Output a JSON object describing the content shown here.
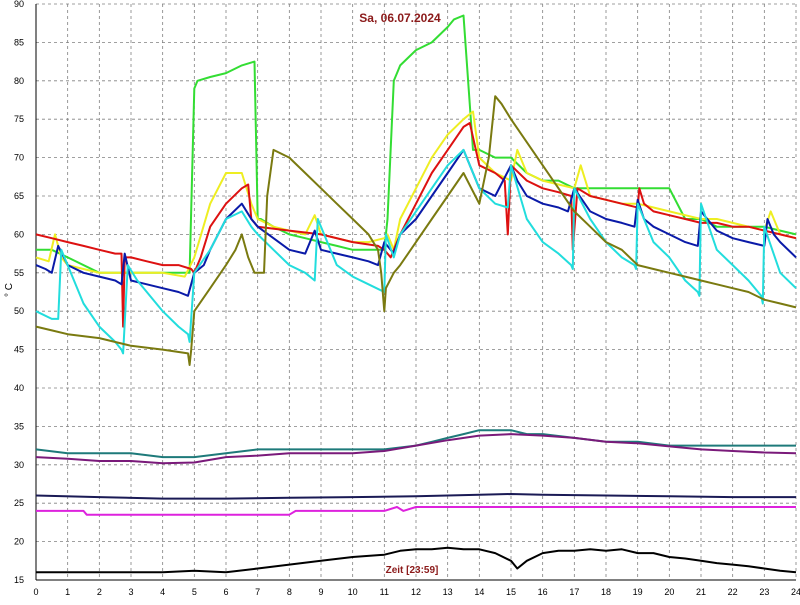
{
  "chart_data": {
    "type": "line",
    "title": "Sa, 06.07.2024",
    "xlabel": "Zeit [23:59]",
    "ylabel": "° C",
    "xlim": [
      0,
      24
    ],
    "ylim": [
      15,
      90
    ],
    "xticks": [
      0,
      1,
      2,
      3,
      4,
      5,
      6,
      7,
      8,
      9,
      10,
      11,
      12,
      13,
      14,
      15,
      16,
      17,
      18,
      19,
      20,
      21,
      22,
      23,
      24
    ],
    "yticks": [
      15,
      20,
      25,
      30,
      35,
      40,
      45,
      50,
      55,
      60,
      65,
      70,
      75,
      80,
      85,
      90
    ],
    "grid": true,
    "colors": {
      "title": "#8b1a1a",
      "xlabel": "#8b1a1a",
      "grid": "#808080",
      "axis": "#000000"
    },
    "series": [
      {
        "color": "#33dd33",
        "x": [
          0,
          0.5,
          1,
          2,
          3,
          4,
          4.75,
          4.85,
          5.0,
          5.1,
          5.5,
          6,
          6.5,
          6.9,
          7.0,
          7.1,
          7.5,
          8,
          8.5,
          9,
          9.5,
          10,
          10.5,
          11.0,
          11.1,
          11.3,
          11.4,
          11.5,
          12,
          12.5,
          13,
          13.2,
          13.5,
          13.8,
          14,
          14.5,
          15,
          15.5,
          16,
          16.5,
          17,
          17.5,
          18,
          18.5,
          19,
          19.5,
          20,
          20.5,
          21,
          21.5,
          22,
          22.5,
          23,
          23.5,
          24
        ],
        "y": [
          58,
          58,
          57,
          55,
          55,
          55,
          55,
          55,
          79,
          80,
          80.5,
          81,
          82,
          82.5,
          62,
          62,
          61,
          60,
          59.5,
          59,
          58.5,
          58,
          58,
          58,
          62,
          80,
          81,
          82,
          84,
          85,
          87,
          88,
          88.5,
          71,
          71,
          70,
          70,
          68,
          67,
          67,
          66,
          66,
          66,
          66,
          66,
          66,
          66,
          62,
          62,
          61,
          61,
          61,
          61,
          60.5,
          60
        ]
      },
      {
        "color": "#eeee22",
        "x": [
          0,
          0.4,
          0.6,
          0.8,
          1,
          1.5,
          2,
          2.8,
          3,
          3.5,
          4,
          4.7,
          5.0,
          5.5,
          6,
          6.5,
          6.8,
          7,
          7.5,
          8,
          8.5,
          8.8,
          9,
          9.5,
          10,
          10.5,
          11,
          11.1,
          11.3,
          11.5,
          12,
          12.5,
          13,
          13.5,
          13.8,
          14,
          14.5,
          15,
          15.2,
          15.5,
          16,
          16.5,
          17,
          17.2,
          17.5,
          18,
          18.5,
          19,
          19.5,
          20,
          20.5,
          21,
          21.5,
          22,
          22.5,
          23,
          23.2,
          23.5,
          24
        ],
        "y": [
          57,
          56.5,
          60,
          57,
          56,
          55.5,
          55,
          55,
          55,
          55,
          55,
          54.5,
          57,
          64,
          68,
          68,
          64,
          62,
          61,
          60.5,
          60,
          62.5,
          60,
          59.5,
          59,
          59,
          59.5,
          60,
          58,
          62,
          66,
          70,
          73,
          75,
          76,
          70,
          68,
          67,
          71,
          68,
          67,
          66.5,
          66,
          69,
          65,
          64.5,
          64,
          64,
          63.5,
          63,
          62.5,
          62,
          62,
          61.5,
          61,
          60.5,
          63,
          60,
          59.5
        ]
      },
      {
        "color": "#dd1111",
        "x": [
          0,
          0.5,
          1,
          1.5,
          2,
          2.5,
          2.7,
          2.75,
          2.8,
          3,
          3.5,
          4,
          4.5,
          4.9,
          5.0,
          5.2,
          5.5,
          6,
          6.5,
          6.7,
          6.8,
          7,
          8,
          9,
          10,
          10.8,
          11,
          11.2,
          11.5,
          12,
          12.5,
          13,
          13.5,
          13.7,
          14,
          14.5,
          14.8,
          14.9,
          15,
          15.5,
          16,
          16.5,
          16.9,
          16.95,
          17.1,
          17.5,
          18,
          18.5,
          19,
          19.05,
          19.2,
          19.5,
          20,
          20.5,
          21,
          21.5,
          22,
          22.5,
          23,
          23.5,
          24
        ],
        "y": [
          60,
          59.5,
          59,
          58.5,
          58,
          57.5,
          57.5,
          48,
          57,
          57,
          56.5,
          56,
          56,
          55.5,
          55,
          57,
          61,
          64,
          66,
          66.5,
          62,
          61,
          60.5,
          60,
          59,
          58.5,
          58,
          57,
          60,
          64,
          68,
          71,
          74,
          74.5,
          69,
          68,
          67,
          60,
          69,
          67,
          66,
          65.5,
          65,
          58,
          66,
          65,
          64.5,
          64,
          63.5,
          66,
          64,
          63,
          62.5,
          62,
          61.5,
          61.5,
          61,
          61,
          60.5,
          60,
          59.5
        ]
      },
      {
        "color": "#0a1aa8",
        "x": [
          0,
          0.3,
          0.5,
          0.7,
          1,
          1.5,
          2,
          2.5,
          2.7,
          2.8,
          3,
          3.5,
          4,
          4.5,
          4.8,
          5.0,
          5.3,
          5.5,
          6,
          6.5,
          6.8,
          7,
          7.5,
          8,
          8.5,
          8.8,
          9,
          9.5,
          10,
          10.5,
          10.8,
          11,
          11.3,
          11.5,
          12,
          12.5,
          13,
          13.5,
          14,
          14.5,
          15,
          15.2,
          15.5,
          16,
          16.5,
          16.8,
          17,
          17.5,
          18,
          18.5,
          18.9,
          19.0,
          19.2,
          19.5,
          20,
          20.5,
          20.9,
          21.0,
          21.5,
          22,
          22.5,
          23,
          23.1,
          23.3,
          23.5,
          24
        ],
        "y": [
          56,
          55.5,
          55,
          58.5,
          56,
          55,
          54.5,
          54,
          53.5,
          57.5,
          54,
          53.5,
          53,
          52.5,
          52,
          55,
          56,
          58,
          62,
          64,
          62,
          61,
          59.5,
          58,
          57.5,
          60.5,
          58,
          57.5,
          57,
          56.5,
          56,
          59,
          57.5,
          60,
          62,
          65,
          68,
          71,
          66,
          65,
          69,
          67,
          65,
          64,
          63.5,
          63,
          66,
          63,
          62,
          61.5,
          61,
          64.5,
          62,
          61,
          60,
          59,
          58.5,
          63,
          60.5,
          59.5,
          59,
          58.5,
          62,
          60,
          59,
          57
        ]
      },
      {
        "color": "#22dddd",
        "x": [
          0,
          0.5,
          0.7,
          0.8,
          1.5,
          2,
          2.5,
          2.7,
          2.75,
          2.9,
          3.2,
          4,
          4.5,
          4.8,
          4.85,
          5.0,
          5.5,
          6,
          6.5,
          6.8,
          7,
          7.5,
          8,
          8.5,
          8.8,
          8.9,
          9.5,
          10,
          10.5,
          11,
          11.05,
          11.3,
          11.5,
          12,
          12.5,
          13,
          13.5,
          14,
          14.5,
          14.9,
          15.0,
          15.5,
          16,
          16.5,
          16.9,
          16.95,
          17.0,
          17.5,
          18,
          18.5,
          18.9,
          18.95,
          19.0,
          19.5,
          20,
          20.5,
          20.9,
          20.95,
          21.0,
          21.5,
          22,
          22.5,
          22.9,
          22.95,
          23.0,
          23.5,
          24
        ],
        "y": [
          50,
          49,
          49,
          58,
          51,
          48,
          46,
          45,
          44.5,
          56,
          54,
          50,
          48,
          47,
          46,
          55,
          58,
          62,
          63,
          61,
          60,
          58,
          56,
          55,
          54,
          62,
          56,
          54.5,
          53.5,
          52.5,
          60,
          57,
          60,
          63,
          66,
          69,
          71,
          66,
          64,
          63.5,
          69,
          62,
          59,
          57.5,
          56,
          55.5,
          66,
          62,
          59,
          57,
          56,
          55.5,
          64,
          59,
          57,
          54,
          52.5,
          52,
          64,
          58,
          56,
          54,
          52,
          51,
          61,
          55,
          53
        ]
      },
      {
        "color": "#7a7a10",
        "x": [
          0,
          0.5,
          1,
          2,
          3,
          4,
          4.8,
          4.85,
          4.9,
          5.0,
          5.5,
          6,
          6.3,
          6.5,
          6.7,
          6.9,
          7.2,
          7.3,
          7.5,
          8,
          8.5,
          9,
          9.5,
          10,
          10.5,
          10.8,
          10.9,
          11.0,
          11.05,
          11.3,
          11.5,
          12,
          12.5,
          13,
          13.5,
          14,
          14.3,
          14.5,
          14.7,
          15,
          15.5,
          16,
          16.5,
          17,
          17.5,
          18,
          18.5,
          19,
          19.5,
          20,
          20.5,
          21,
          21.5,
          22,
          22.5,
          23,
          23.5,
          24
        ],
        "y": [
          48,
          47.5,
          47,
          46.5,
          45.5,
          45,
          44.5,
          43,
          45,
          50,
          53,
          56,
          58,
          60,
          57,
          55,
          55,
          65,
          71,
          70,
          68,
          66,
          64,
          62,
          60,
          58,
          55,
          50,
          53,
          55,
          56,
          59,
          62,
          65,
          68,
          64,
          70,
          78,
          77,
          75,
          72,
          69,
          66,
          63,
          61,
          59,
          58,
          56,
          55.5,
          55,
          54.5,
          54,
          53.5,
          53,
          52.5,
          51.5,
          51,
          50.5
        ]
      },
      {
        "color": "#1e7a7a",
        "x": [
          0,
          1,
          2,
          3,
          4,
          5,
          6,
          7,
          8,
          9,
          10,
          11,
          12,
          12.5,
          13,
          13.5,
          14,
          14.5,
          15,
          15.5,
          16,
          17,
          18,
          19,
          20,
          21,
          22,
          23,
          24
        ],
        "y": [
          32,
          31.5,
          31.5,
          31.5,
          31,
          31,
          31.5,
          32,
          32,
          32,
          32,
          32,
          32.5,
          33,
          33.5,
          34,
          34.5,
          34.5,
          34.5,
          34,
          34,
          33.5,
          33,
          33,
          32.5,
          32.5,
          32.5,
          32.5,
          32.5
        ]
      },
      {
        "color": "#7a1a7a",
        "x": [
          0,
          1,
          2,
          3,
          4,
          5,
          6,
          7,
          8,
          9,
          10,
          11,
          12,
          13,
          14,
          15,
          16,
          17,
          18,
          19,
          20,
          21,
          22,
          23,
          24
        ],
        "y": [
          31,
          30.8,
          30.5,
          30.5,
          30.2,
          30.3,
          31,
          31.2,
          31.5,
          31.5,
          31.5,
          31.8,
          32.5,
          33.2,
          33.8,
          34,
          33.8,
          33.5,
          33,
          32.8,
          32.4,
          32,
          31.8,
          31.6,
          31.5
        ]
      },
      {
        "color": "#1a1a55",
        "x": [
          0,
          2,
          4,
          6,
          8,
          10,
          12,
          13,
          14,
          15,
          16,
          18,
          20,
          22,
          24
        ],
        "y": [
          26,
          25.8,
          25.6,
          25.6,
          25.7,
          25.8,
          25.9,
          26,
          26.1,
          26.2,
          26.1,
          26,
          25.9,
          25.8,
          25.8
        ]
      },
      {
        "color": "#dd22dd",
        "x": [
          0,
          1.5,
          1.6,
          5,
          8,
          8.2,
          11,
          11.4,
          11.6,
          12,
          13,
          14,
          15,
          16,
          18,
          20,
          22,
          23,
          24
        ],
        "y": [
          24,
          24,
          23.5,
          23.5,
          23.5,
          24,
          24,
          24.5,
          24,
          24.5,
          24.5,
          24.5,
          24.5,
          24.5,
          24.5,
          24.5,
          24.5,
          24.5,
          24.5
        ]
      },
      {
        "color": "#000000",
        "x": [
          0,
          1,
          2,
          3,
          4,
          5,
          6,
          7,
          8,
          9,
          10,
          11,
          11.5,
          12,
          12.5,
          13,
          13.5,
          14,
          14.5,
          15,
          15.2,
          15.5,
          16,
          16.5,
          17,
          17.5,
          18,
          18.5,
          19,
          19.5,
          20,
          20.5,
          21,
          21.5,
          22,
          22.5,
          23,
          23.5,
          24
        ],
        "y": [
          16,
          16,
          16,
          16,
          16,
          16.2,
          16,
          16.5,
          17,
          17.5,
          18,
          18.3,
          18.8,
          19,
          19,
          19.2,
          19,
          19,
          18.5,
          17.5,
          16.5,
          17.5,
          18.5,
          18.8,
          18.8,
          19,
          18.8,
          19,
          18.5,
          18.5,
          18,
          17.8,
          17.5,
          17.2,
          17,
          16.8,
          16.5,
          16.2,
          16
        ]
      }
    ]
  }
}
